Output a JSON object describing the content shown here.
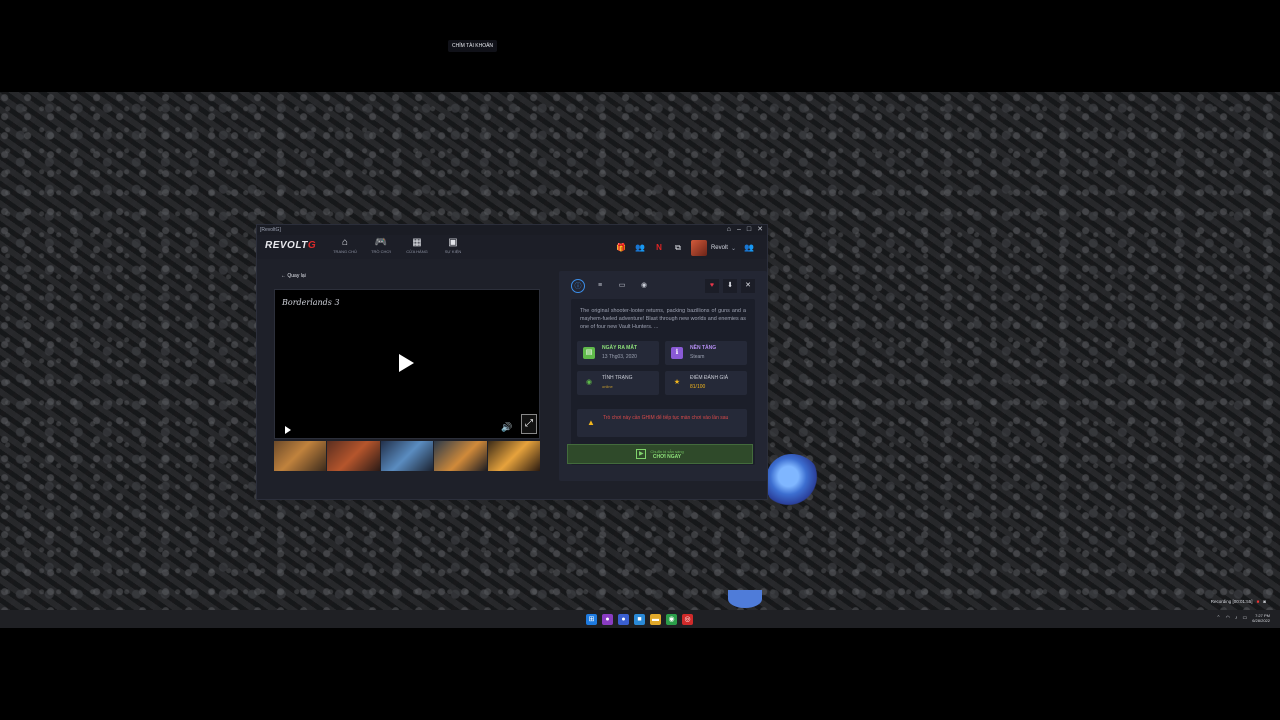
{
  "window": {
    "title": "[RevoltG]",
    "controls": [
      "⌂",
      "–",
      "□",
      "✕"
    ]
  },
  "app": {
    "logo_main": "REVOLT",
    "logo_accent": "G",
    "nav": [
      {
        "icon": "home-icon",
        "glyph": "⌂",
        "label": "TRANG CHỦ"
      },
      {
        "icon": "gamepad-icon",
        "glyph": "🎮",
        "label": "TRÒ CHƠI"
      },
      {
        "icon": "store-icon",
        "glyph": "▦",
        "label": "CỬA HÀNG"
      },
      {
        "icon": "calendar-icon",
        "glyph": "▣",
        "label": "SỰ KIỆN"
      }
    ],
    "tools": [
      "🎁",
      "👥",
      "N",
      "⧉"
    ],
    "username": "Revolt",
    "chevron": "⌄",
    "friends_glyph": "👥"
  },
  "detail": {
    "back_label": "Quay lại",
    "video_title": "Borderlands 3",
    "tooltip": "CHỈM TÀI KHOẢN",
    "tabs": [
      "ⓘ",
      "≡",
      "▭",
      "◉"
    ],
    "actions": [
      "♥",
      "⬇",
      "✕"
    ],
    "description": "The original shooter-looter returns, packing bazillions of guns and a mayhem-fueled adventure! Blast through new worlds and enemies as one of four new Vault Hunters. ...",
    "release_label": "NGÀY RA MẮT",
    "release_value": "13 Thg03, 2020",
    "platform_label": "NỀN TẢNG",
    "platform_value": "Steam",
    "status_label": "TÌNH TRẠNG",
    "status_value": "online",
    "rating_label": "ĐIỂM ĐÁNH GIÁ",
    "rating_value": "81/100",
    "warning": "Trò chơi này cần GHIM để tiếp tục màn chơi vào lần sau",
    "play_sub": "Chuẩn bị sẵn sàng",
    "play_label": "CHƠI NGAY",
    "colors": {
      "accent": "#3b8eea",
      "green": "#8ee27a",
      "red": "#d84a4a",
      "gold": "#f2b51c"
    }
  },
  "taskbar": {
    "recording": "Recording [00:01:55]",
    "time": "7:27 PM",
    "date": "6/28/2022"
  }
}
